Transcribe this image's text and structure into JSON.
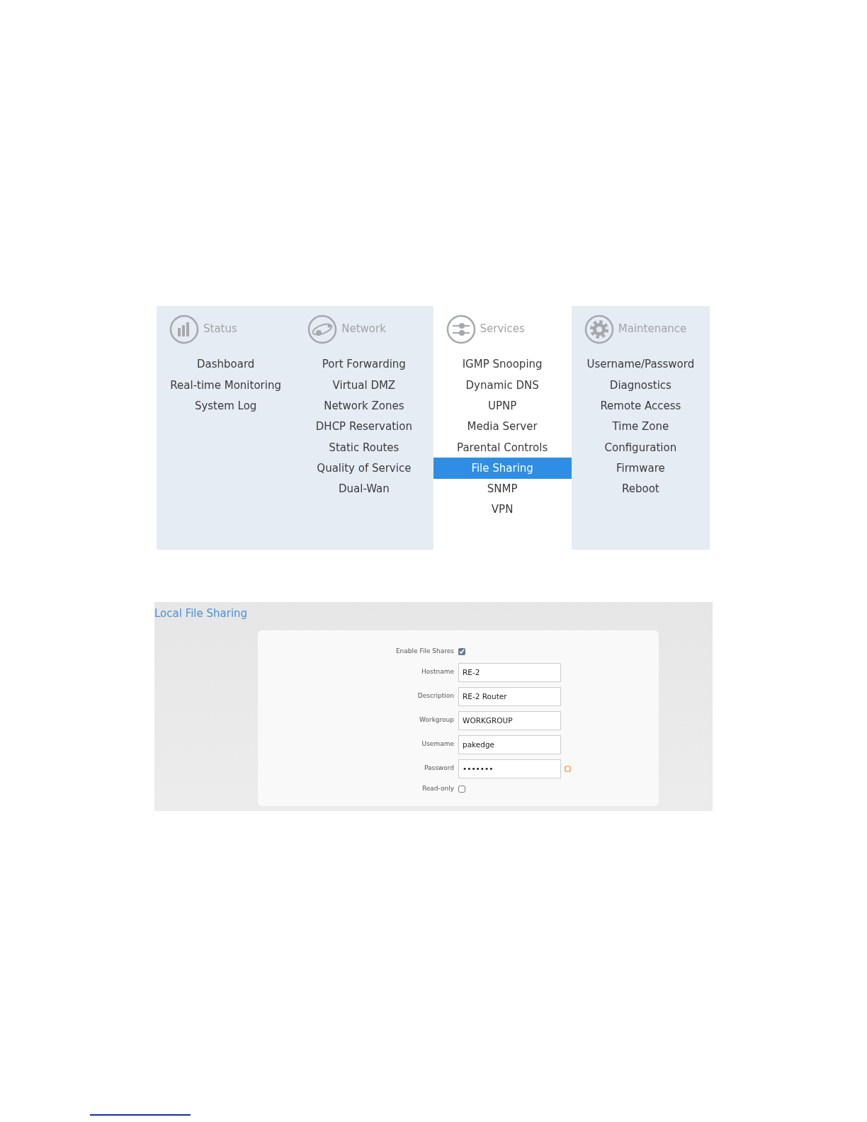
{
  "menu": {
    "columns": [
      {
        "title": "Status",
        "kind": "chart",
        "active": false,
        "items": [
          {
            "label": "Dashboard",
            "selected": false
          },
          {
            "label": "Real-time Monitoring",
            "selected": false
          },
          {
            "label": "System Log",
            "selected": false
          }
        ]
      },
      {
        "title": "Network",
        "kind": "network",
        "active": false,
        "items": [
          {
            "label": "Port Forwarding",
            "selected": false
          },
          {
            "label": "Virtual DMZ",
            "selected": false
          },
          {
            "label": "Network Zones",
            "selected": false
          },
          {
            "label": "DHCP Reservation",
            "selected": false
          },
          {
            "label": "Static Routes",
            "selected": false
          },
          {
            "label": "Quality of Service",
            "selected": false
          },
          {
            "label": "Dual-Wan",
            "selected": false
          }
        ]
      },
      {
        "title": "Services",
        "kind": "sliders",
        "active": true,
        "items": [
          {
            "label": "IGMP Snooping",
            "selected": false
          },
          {
            "label": "Dynamic DNS",
            "selected": false
          },
          {
            "label": "UPNP",
            "selected": false
          },
          {
            "label": "Media Server",
            "selected": false
          },
          {
            "label": "Parental Controls",
            "selected": false
          },
          {
            "label": "File Sharing",
            "selected": true
          },
          {
            "label": "SNMP",
            "selected": false
          },
          {
            "label": "VPN",
            "selected": false
          }
        ]
      },
      {
        "title": "Maintenance",
        "kind": "gear",
        "active": false,
        "items": [
          {
            "label": "Username/Password",
            "selected": false
          },
          {
            "label": "Diagnostics",
            "selected": false
          },
          {
            "label": "Remote Access",
            "selected": false
          },
          {
            "label": "Time Zone",
            "selected": false
          },
          {
            "label": "Configuration",
            "selected": false
          },
          {
            "label": "Firmware",
            "selected": false
          },
          {
            "label": "Reboot",
            "selected": false
          }
        ]
      }
    ]
  },
  "form": {
    "title": "Local File Sharing",
    "fields": [
      {
        "kind": "checkbox",
        "label": "Enable File Shares",
        "checked": true
      },
      {
        "kind": "text",
        "label": "Hostname",
        "value": "RE-2"
      },
      {
        "kind": "text",
        "label": "Description",
        "value": "RE-2 Router"
      },
      {
        "kind": "text",
        "label": "Workgroup",
        "value": "WORKGROUP"
      },
      {
        "kind": "text",
        "label": "Usemame",
        "value": "pakedge"
      },
      {
        "kind": "password",
        "label": "Password",
        "value": "•••••••"
      },
      {
        "kind": "checkbox",
        "label": "Read-only",
        "checked": false
      }
    ]
  }
}
